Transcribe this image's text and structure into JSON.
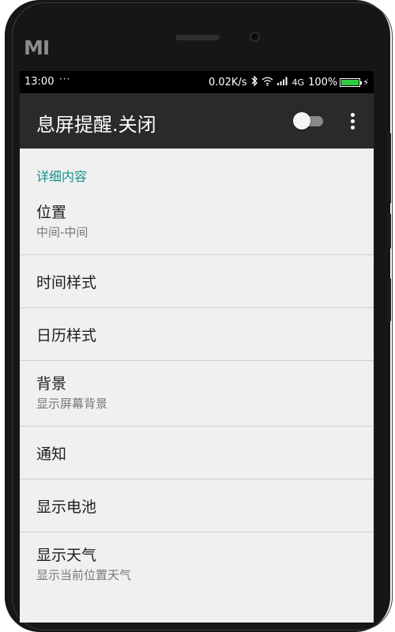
{
  "device": {
    "logo": "MI"
  },
  "status_bar": {
    "time": "13:00",
    "more": "···",
    "speed": "0.02K/s",
    "network": "4G",
    "battery": "100%",
    "battery_level": 1.0,
    "icons": [
      "bluetooth-icon",
      "wifi-icon",
      "signal-icon",
      "battery-icon",
      "charging-icon"
    ]
  },
  "app_bar": {
    "title": "息屏提醒.关闭",
    "toggle_on": false
  },
  "section": {
    "header": "详细内容"
  },
  "items": [
    {
      "title": "位置",
      "subtitle": "中间-中间"
    },
    {
      "title": "时间样式"
    },
    {
      "title": "日历样式"
    },
    {
      "title": "背景",
      "subtitle": "显示屏幕背景"
    },
    {
      "title": "通知"
    },
    {
      "title": "显示电池"
    },
    {
      "title": "显示天气",
      "subtitle": "显示当前位置天气"
    }
  ],
  "colors": {
    "accent": "#15938c",
    "appbar": "#2a2a2a",
    "background": "#f0f0f0"
  }
}
